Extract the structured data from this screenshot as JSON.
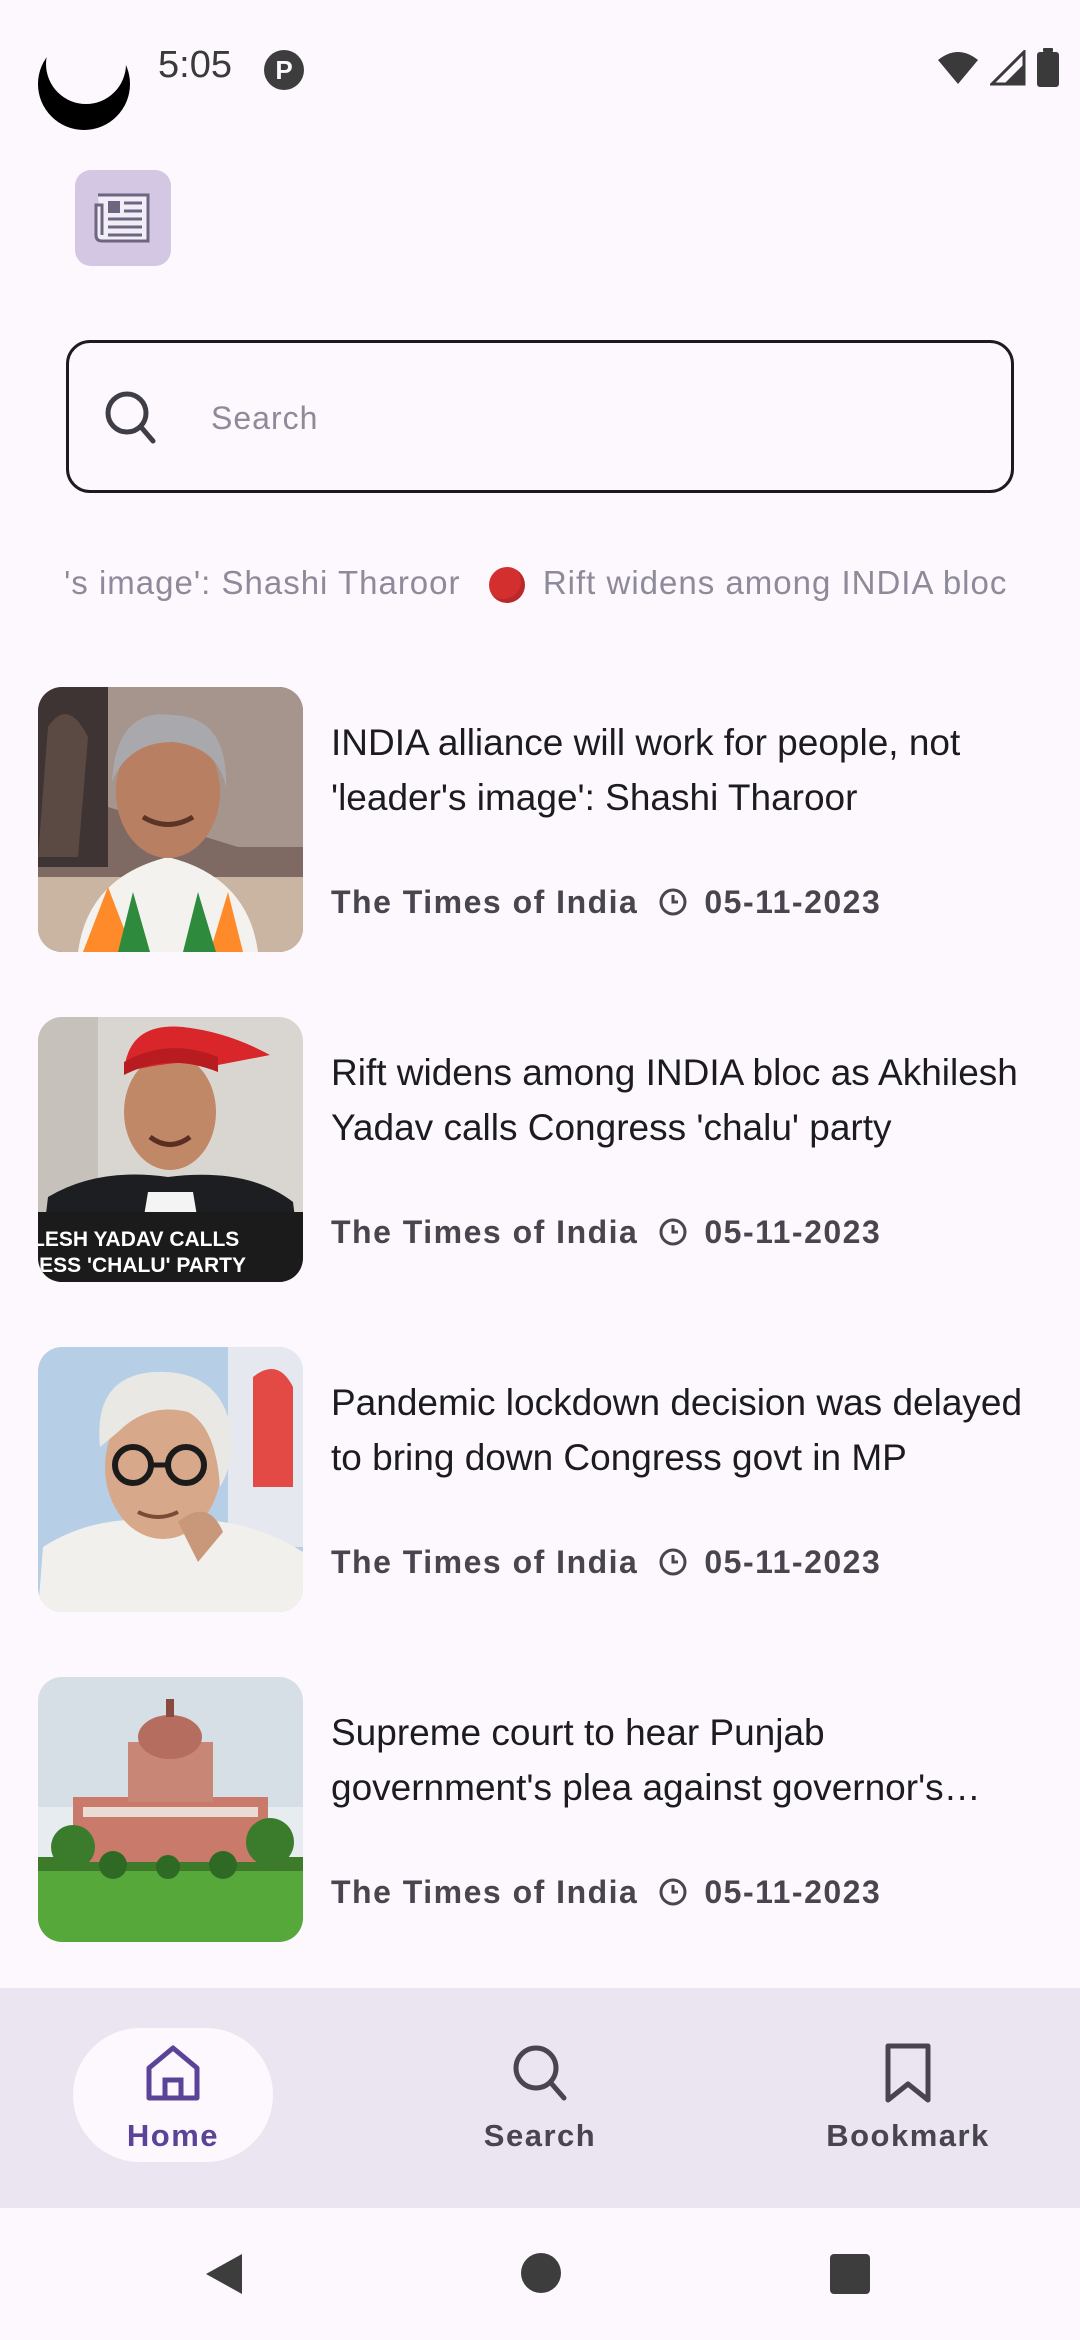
{
  "status_bar": {
    "time": "5:05",
    "notification_letter": "P"
  },
  "app": {
    "icon": "newspaper-icon"
  },
  "search": {
    "placeholder": "Search"
  },
  "ticker": {
    "items": [
      "r's image': Shashi Tharoor",
      "Rift widens among INDIA bloc as Akhilesh Yadav calls Congress 'chalu' party"
    ]
  },
  "news": [
    {
      "title": "INDIA alliance will work for people, not 'leader's image': Shashi Tharoor",
      "source": "The Times of India",
      "date": "05-11-2023"
    },
    {
      "title": "Rift widens among INDIA bloc as Akhilesh Yadav calls Congress 'chalu' party",
      "source": "The Times of India",
      "date": "05-11-2023",
      "image_caption_line1": "LESH YADAV CALLS",
      "image_caption_line2": "RESS 'CHALU' PARTY"
    },
    {
      "title": "Pandemic lockdown decision was delayed to bring down Congress govt in MP",
      "source": "The Times of India",
      "date": "05-11-2023"
    },
    {
      "title": "Supreme court to hear Punjab government's plea against governor's delay",
      "source": "The Times of India",
      "date": "05-11-2023"
    }
  ],
  "bottom_nav": {
    "home": "Home",
    "search": "Search",
    "bookmark": "Bookmark",
    "active": "Home"
  },
  "colors": {
    "background": "#fdf8fd",
    "accent": "#5b4397",
    "nav_background": "#ebe5f1",
    "app_icon_bg": "#d3c7e4"
  }
}
